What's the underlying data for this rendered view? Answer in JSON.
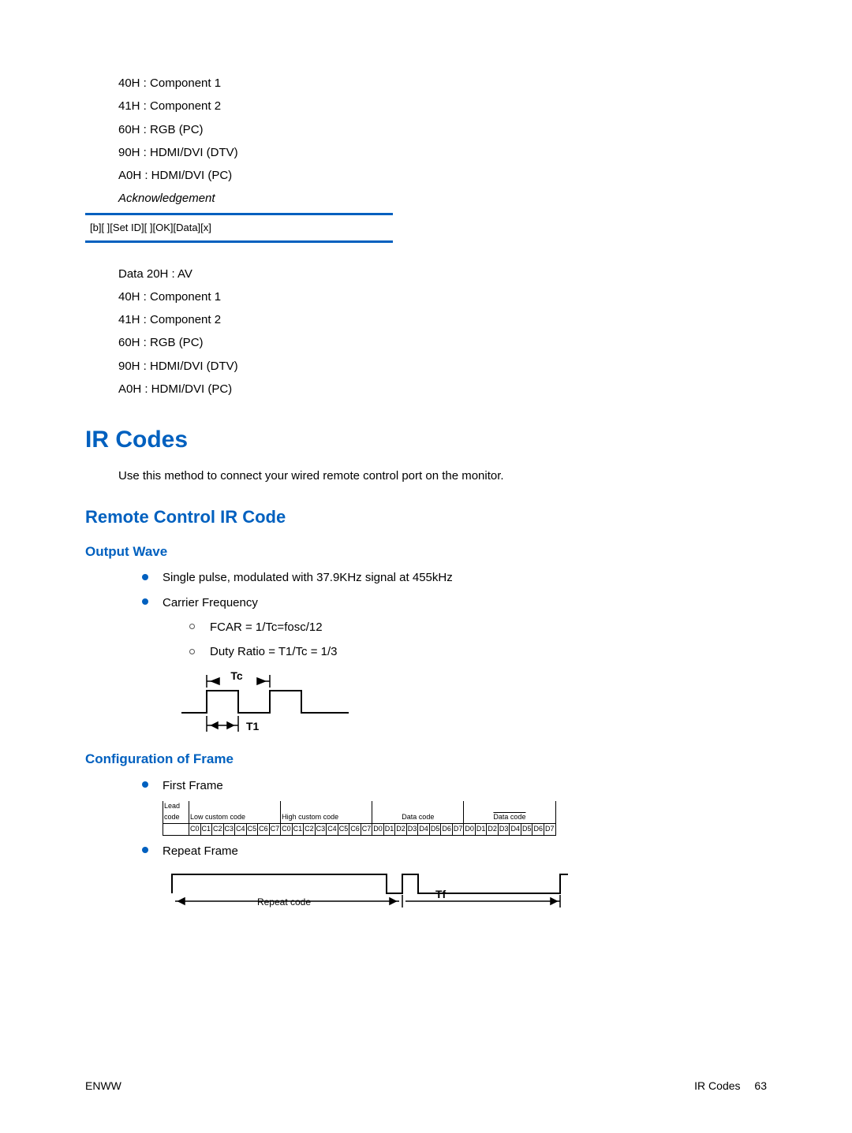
{
  "inputCodes1": [
    "40H : Component 1",
    "41H : Component 2",
    "60H : RGB (PC)",
    "90H : HDMI/DVI (DTV)",
    "A0H : HDMI/DVI (PC)"
  ],
  "ack": {
    "label": "Acknowledgement",
    "response": "[b][ ][Set ID][ ][OK][Data][x]"
  },
  "inputCodes2": [
    "Data 20H : AV",
    "40H : Component 1",
    "41H : Component 2",
    "60H : RGB (PC)",
    "90H : HDMI/DVI (DTV)",
    "A0H : HDMI/DVI (PC)"
  ],
  "headings": {
    "ir_codes": "IR Codes",
    "ir_codes_lead": "Use this method to connect your wired remote control port on the monitor.",
    "remote": "Remote Control IR Code",
    "output_wave": "Output Wave",
    "config_frame": "Configuration of Frame"
  },
  "outputWave": {
    "b1": "Single pulse, modulated with 37.9KHz signal at 455kHz",
    "b2": "Carrier Frequency",
    "s1": "FCAR = 1/Tc=fosc/12",
    "s2": "Duty Ratio = T1/Tc = 1/3",
    "fig": {
      "tc": "Tc",
      "t1": "T1"
    }
  },
  "configFrame": {
    "b1": "First Frame",
    "b2": "Repeat Frame",
    "firstFrame": {
      "headers": [
        "Lead code",
        "Low custom code",
        "High custom code",
        "Data code",
        "Data code"
      ],
      "bits": [
        "C0",
        "C1",
        "C2",
        "C3",
        "C4",
        "C5",
        "C6",
        "C7",
        "C0",
        "C1",
        "C2",
        "C3",
        "C4",
        "C5",
        "C6",
        "C7",
        "D0",
        "D1",
        "D2",
        "D3",
        "D4",
        "D5",
        "D6",
        "D7",
        "D0",
        "D1",
        "D2",
        "D3",
        "D4",
        "D5",
        "D6",
        "D7"
      ]
    },
    "repeatFig": {
      "repeat_code": "Repeat code",
      "tf": "Tf"
    }
  },
  "footer": {
    "left": "ENWW",
    "right_label": "IR Codes",
    "page": "63"
  }
}
